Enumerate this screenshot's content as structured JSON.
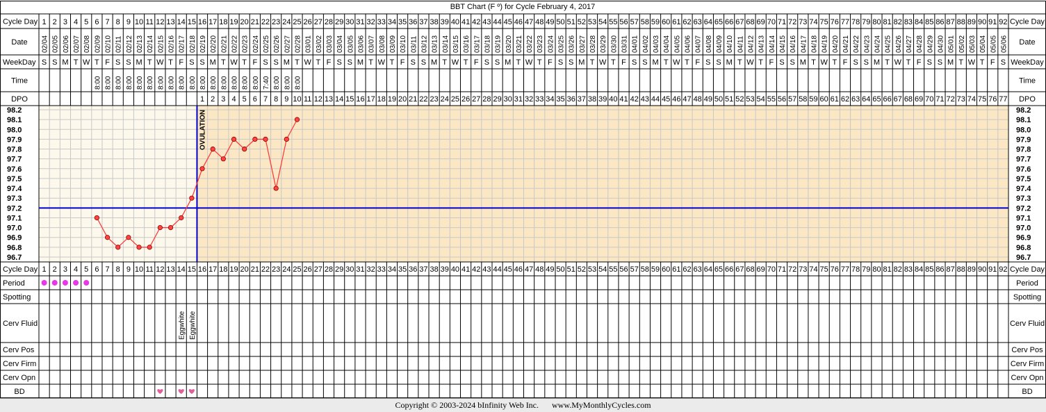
{
  "title": "BBT Chart (F º) for Cycle February 4, 2017",
  "row_labels": {
    "cycle_day": "Cycle Day",
    "date": "Date",
    "weekday": "WeekDay",
    "time": "Time",
    "dpo": "DPO",
    "period": "Period",
    "spotting": "Spotting",
    "cerv_fluid": "Cerv Fluid",
    "cerv_pos": "Cerv Pos",
    "cerv_firm": "Cerv Firm",
    "cerv_opn": "Cerv Opn",
    "bd": "BD"
  },
  "cycle_days": [
    1,
    2,
    3,
    4,
    5,
    6,
    7,
    8,
    9,
    10,
    11,
    12,
    13,
    14,
    15,
    16,
    17,
    18,
    19,
    20,
    21,
    22,
    23,
    24,
    25,
    26,
    27,
    28,
    29,
    30,
    31,
    32,
    33,
    34,
    35,
    36,
    37,
    38,
    39,
    40,
    41,
    42,
    43,
    44,
    45,
    46,
    47,
    48,
    49,
    50,
    51,
    52,
    53,
    54,
    55,
    56,
    57,
    58,
    59,
    60,
    61,
    62,
    63,
    64,
    65,
    66,
    67,
    68,
    69,
    70,
    71,
    72,
    73,
    74,
    75,
    76,
    77,
    78,
    79,
    80,
    81,
    82,
    83,
    84,
    85,
    86,
    87,
    88,
    89,
    90,
    91,
    92
  ],
  "dates": [
    "02/04",
    "02/05",
    "02/06",
    "02/07",
    "02/08",
    "02/09",
    "02/10",
    "02/11",
    "02/12",
    "02/13",
    "02/14",
    "02/15",
    "02/16",
    "02/17",
    "02/18",
    "02/19",
    "02/20",
    "02/21",
    "02/22",
    "02/23",
    "02/24",
    "02/25",
    "02/26",
    "02/27",
    "02/28",
    "03/01",
    "03/02",
    "03/03",
    "03/04",
    "03/05",
    "03/06",
    "03/07",
    "03/08",
    "03/09",
    "03/10",
    "03/11",
    "03/12",
    "03/13",
    "03/14",
    "03/15",
    "03/16",
    "03/17",
    "03/18",
    "03/19",
    "03/20",
    "03/21",
    "03/22",
    "03/23",
    "03/24",
    "03/25",
    "03/26",
    "03/27",
    "03/28",
    "03/29",
    "03/30",
    "03/31",
    "04/01",
    "04/02",
    "04/03",
    "04/04",
    "04/05",
    "04/06",
    "04/07",
    "04/08",
    "04/09",
    "04/10",
    "04/11",
    "04/12",
    "04/13",
    "04/14",
    "04/15",
    "04/16",
    "04/17",
    "04/18",
    "04/19",
    "04/20",
    "04/21",
    "04/22",
    "04/23",
    "04/24",
    "04/25",
    "04/26",
    "04/27",
    "04/28",
    "04/29",
    "04/30",
    "05/01",
    "05/02",
    "05/03",
    "05/04",
    "05/05",
    "05/06"
  ],
  "weekdays": [
    "S",
    "S",
    "M",
    "T",
    "W",
    "T",
    "F",
    "S",
    "S",
    "M",
    "T",
    "W",
    "T",
    "F",
    "S",
    "S",
    "M",
    "T",
    "W",
    "T",
    "F",
    "S",
    "S",
    "M",
    "T",
    "W",
    "T",
    "F",
    "S",
    "S",
    "M",
    "T",
    "W",
    "T",
    "F",
    "S",
    "S",
    "M",
    "T",
    "W",
    "T",
    "F",
    "S",
    "S",
    "M",
    "T",
    "W",
    "T",
    "F",
    "S",
    "S",
    "M",
    "T",
    "W",
    "T",
    "F",
    "S",
    "S",
    "M",
    "T",
    "W",
    "T",
    "F",
    "S",
    "S",
    "M",
    "T",
    "W",
    "T",
    "F",
    "S",
    "S",
    "M",
    "T",
    "W",
    "T",
    "F",
    "S",
    "S",
    "M",
    "T",
    "W",
    "T",
    "F",
    "S",
    "S",
    "M",
    "T",
    "W",
    "T",
    "F",
    "S"
  ],
  "times": [
    "",
    "",
    "",
    "",
    "",
    "8:00",
    "8:00",
    "8:00",
    "8:00",
    "8:00",
    "8:00",
    "8:00",
    "8:00",
    "8:00",
    "8:00",
    "8:00",
    "8:00",
    "8:00",
    "8:00",
    "8:00",
    "8:00",
    "7:40",
    "8:00",
    "8:00",
    "8:00",
    "",
    "",
    "",
    "",
    "",
    "",
    "",
    "",
    "",
    "",
    "",
    "",
    "",
    "",
    "",
    "",
    "",
    "",
    "",
    "",
    "",
    "",
    "",
    "",
    "",
    "",
    "",
    "",
    "",
    "",
    "",
    "",
    "",
    "",
    "",
    "",
    "",
    "",
    "",
    "",
    "",
    "",
    "",
    "",
    "",
    "",
    "",
    "",
    "",
    "",
    "",
    "",
    "",
    "",
    "",
    "",
    "",
    "",
    "",
    "",
    "",
    "",
    "",
    "",
    "",
    "",
    "",
    ""
  ],
  "dpo_start_day": 16,
  "dpo_values": [
    1,
    2,
    3,
    4,
    5,
    6,
    7,
    8,
    9,
    10,
    11,
    12,
    13,
    14,
    15,
    16,
    17,
    18,
    19,
    20,
    21,
    22,
    23,
    24,
    25,
    26,
    27,
    28,
    29,
    30,
    31,
    32,
    33,
    34,
    35,
    36,
    37,
    38,
    39,
    40,
    41,
    42,
    43,
    44,
    45,
    46,
    47,
    48,
    49,
    50,
    51,
    52,
    53,
    54,
    55,
    56,
    57,
    58,
    59,
    60,
    61,
    62,
    63,
    64,
    65,
    66,
    67,
    68,
    69,
    70,
    71,
    72,
    73,
    74,
    75,
    76,
    77
  ],
  "ovulation_label": "OVULATION",
  "ovulation_day": 15,
  "coverline": 97.2,
  "period_days": [
    1,
    2,
    3,
    4,
    5
  ],
  "cerv_fluid": [
    {
      "day": 14,
      "label": "Eggwhite"
    },
    {
      "day": 15,
      "label": "Eggwhite"
    }
  ],
  "bd_days": [
    12,
    14,
    15
  ],
  "colors": {
    "follicular_bg": "#fcf8ec",
    "luteal_bg": "#fbe7c4",
    "temp_line": "#ff3333",
    "temp_point": "#ff4444",
    "coverline": "#0000cc",
    "period_dot": "#e638e6",
    "bd_heart": "#e0609a"
  },
  "chart_data": {
    "type": "line",
    "title": "BBT Chart (F º) for Cycle February 4, 2017",
    "x": [
      6,
      7,
      8,
      9,
      10,
      11,
      12,
      13,
      14,
      15,
      16,
      17,
      18,
      19,
      20,
      21,
      22,
      23,
      24,
      25
    ],
    "y": [
      97.1,
      96.9,
      96.8,
      96.9,
      96.8,
      96.8,
      97.0,
      97.0,
      97.1,
      97.3,
      97.6,
      97.8,
      97.7,
      97.9,
      97.8,
      97.9,
      97.9,
      97.4,
      97.9,
      98.1
    ],
    "ylim": [
      96.7,
      98.2
    ],
    "yticks": [
      "98.2",
      "98.1",
      "98.0",
      "97.9",
      "97.8",
      "97.7",
      "97.6",
      "97.5",
      "97.4",
      "97.3",
      "97.2",
      "97.1",
      "97.0",
      "96.9",
      "96.8",
      "96.7"
    ],
    "xlabel": "Cycle Day",
    "ylabel": "",
    "grid": true
  },
  "footer": {
    "copyright": "Copyright © 2003-2024 bInfinity Web Inc.",
    "site": "www.MyMonthlyCycles.com"
  }
}
